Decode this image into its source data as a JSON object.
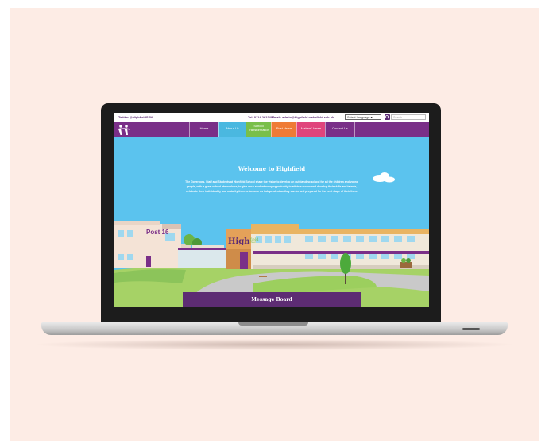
{
  "topbar": {
    "twitter": "Twitter @HighfieldSEN",
    "tel": "Tel: 0114 2622406",
    "email": "Email: admin@highfield.wakefield.sch.uk",
    "language_select": "Select Language",
    "search_placeholder": "Search..."
  },
  "nav": {
    "items": [
      {
        "label": "Home",
        "color": "#7a2f88"
      },
      {
        "label": "About Us",
        "color": "#4ab8e0"
      },
      {
        "label": "School Transformation",
        "color": "#79bf4a"
      },
      {
        "label": "Post Verse",
        "color": "#ef7b36"
      },
      {
        "label": "Makers' Verse",
        "color": "#e0457c"
      },
      {
        "label": "Contact Us",
        "color": "#7a2f88"
      }
    ]
  },
  "hero": {
    "title": "Welcome to Highfield",
    "intro": "The Governors, Staff and Students at Highfield School share the vision to develop an outstanding school for all the children and young people, with a great school atmosphere, to give each student every opportunity to attain success and develop their skills and talents, celebrate their individuality and maturity them to become as independent as they can be and prepared for the next stage of their lives."
  },
  "buildings": {
    "post16_sign": "Post 16",
    "school_sign_main": "High",
    "school_sign_small": "field",
    "school_sign_sub": "school"
  },
  "message_board": {
    "title": "Message Board"
  },
  "colors": {
    "purple": "#7a2f88",
    "sky": "#5bc3ee",
    "grass": "#9fcf60"
  }
}
